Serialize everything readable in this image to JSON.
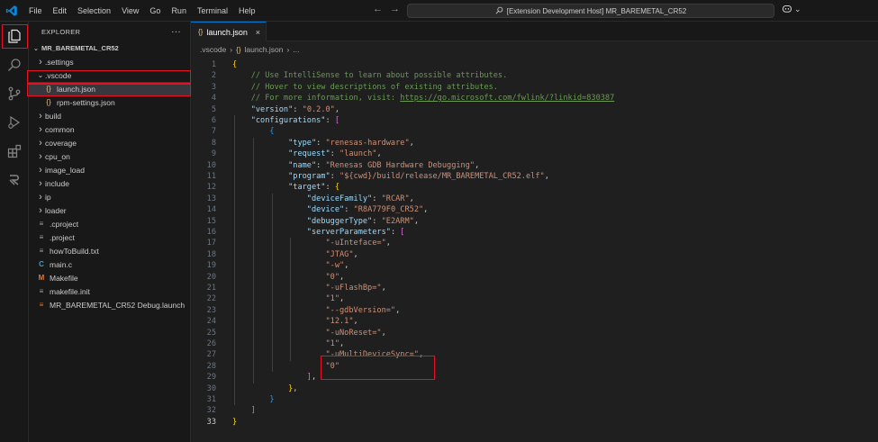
{
  "titlebar": {
    "menu": [
      "File",
      "Edit",
      "Selection",
      "View",
      "Go",
      "Run",
      "Terminal",
      "Help"
    ],
    "search_text": "[Extension Development Host] MR_BAREMETAL_CR52"
  },
  "sidebar": {
    "header": "EXPLORER",
    "more": "···",
    "root": "MR_BAREMETAL_CR52",
    "items": [
      {
        "label": ".settings",
        "kind": "folder",
        "depth": 1,
        "expanded": false
      },
      {
        "label": ".vscode",
        "kind": "folder",
        "depth": 1,
        "expanded": true
      },
      {
        "label": "launch.json",
        "kind": "json",
        "depth": 2,
        "selected": true
      },
      {
        "label": "rpm-settings.json",
        "kind": "json",
        "depth": 2
      },
      {
        "label": "build",
        "kind": "folder",
        "depth": 1,
        "expanded": false
      },
      {
        "label": "common",
        "kind": "folder",
        "depth": 1,
        "expanded": false
      },
      {
        "label": "coverage",
        "kind": "folder",
        "depth": 1,
        "expanded": false
      },
      {
        "label": "cpu_on",
        "kind": "folder",
        "depth": 1,
        "expanded": false
      },
      {
        "label": "image_load",
        "kind": "folder",
        "depth": 1,
        "expanded": false
      },
      {
        "label": "include",
        "kind": "folder",
        "depth": 1,
        "expanded": false
      },
      {
        "label": "ip",
        "kind": "folder",
        "depth": 1,
        "expanded": false
      },
      {
        "label": "loader",
        "kind": "folder",
        "depth": 1,
        "expanded": false
      },
      {
        "label": ".cproject",
        "kind": "file",
        "depth": 1
      },
      {
        "label": ".project",
        "kind": "file",
        "depth": 1
      },
      {
        "label": "howToBuild.txt",
        "kind": "file",
        "depth": 1
      },
      {
        "label": "main.c",
        "kind": "c",
        "depth": 1
      },
      {
        "label": "Makefile",
        "kind": "makefile",
        "depth": 1
      },
      {
        "label": "makefile.init",
        "kind": "file",
        "depth": 1
      },
      {
        "label": "MR_BAREMETAL_CR52 Debug.launch",
        "kind": "launch",
        "depth": 1
      }
    ]
  },
  "editor": {
    "tab_label": "launch.json",
    "tab_icon": "{}",
    "breadcrumb": [
      ".vscode",
      "launch.json",
      "..."
    ],
    "lines": [
      [
        [
          "{",
          "c-brace"
        ]
      ],
      [
        [
          "    // Use IntelliSense to learn about possible attributes.",
          "c-comment"
        ]
      ],
      [
        [
          "    // Hover to view descriptions of existing attributes.",
          "c-comment"
        ]
      ],
      [
        [
          "    // For more information, visit: ",
          "c-comment"
        ],
        [
          "https://go.microsoft.com/fwlink/?linkid=830387",
          "c-link"
        ]
      ],
      [
        [
          "    ",
          ""
        ],
        [
          "\"version\"",
          "c-key"
        ],
        [
          ": ",
          "c-punct"
        ],
        [
          "\"0.2.0\"",
          "c-str"
        ],
        [
          ",",
          "c-punct"
        ]
      ],
      [
        [
          "    ",
          ""
        ],
        [
          "\"configurations\"",
          "c-key"
        ],
        [
          ": ",
          "c-punct"
        ],
        [
          "[",
          "c-bracket2"
        ]
      ],
      [
        [
          "        ",
          ""
        ],
        [
          "{",
          "c-bracket3"
        ]
      ],
      [
        [
          "            ",
          ""
        ],
        [
          "\"type\"",
          "c-key"
        ],
        [
          ": ",
          "c-punct"
        ],
        [
          "\"renesas-hardware\"",
          "c-str"
        ],
        [
          ",",
          "c-punct"
        ]
      ],
      [
        [
          "            ",
          ""
        ],
        [
          "\"request\"",
          "c-key"
        ],
        [
          ": ",
          "c-punct"
        ],
        [
          "\"launch\"",
          "c-str"
        ],
        [
          ",",
          "c-punct"
        ]
      ],
      [
        [
          "            ",
          ""
        ],
        [
          "\"name\"",
          "c-key"
        ],
        [
          ": ",
          "c-punct"
        ],
        [
          "\"Renesas GDB Hardware Debugging\"",
          "c-str"
        ],
        [
          ",",
          "c-punct"
        ]
      ],
      [
        [
          "            ",
          ""
        ],
        [
          "\"program\"",
          "c-key"
        ],
        [
          ": ",
          "c-punct"
        ],
        [
          "\"${cwd}/build/release/MR_BAREMETAL_CR52.elf\"",
          "c-str"
        ],
        [
          ",",
          "c-punct"
        ]
      ],
      [
        [
          "            ",
          ""
        ],
        [
          "\"target\"",
          "c-key"
        ],
        [
          ": ",
          "c-punct"
        ],
        [
          "{",
          "c-brace"
        ]
      ],
      [
        [
          "                ",
          ""
        ],
        [
          "\"deviceFamily\"",
          "c-key"
        ],
        [
          ": ",
          "c-punct"
        ],
        [
          "\"RCAR\"",
          "c-str"
        ],
        [
          ",",
          "c-punct"
        ]
      ],
      [
        [
          "                ",
          ""
        ],
        [
          "\"device\"",
          "c-key"
        ],
        [
          ": ",
          "c-punct"
        ],
        [
          "\"R8A779F0_CR52\"",
          "c-str"
        ],
        [
          ",",
          "c-punct"
        ]
      ],
      [
        [
          "                ",
          ""
        ],
        [
          "\"debuggerType\"",
          "c-key"
        ],
        [
          ": ",
          "c-punct"
        ],
        [
          "\"E2ARM\"",
          "c-str"
        ],
        [
          ",",
          "c-punct"
        ]
      ],
      [
        [
          "                ",
          ""
        ],
        [
          "\"serverParameters\"",
          "c-key"
        ],
        [
          ": ",
          "c-punct"
        ],
        [
          "[",
          "c-bracket2"
        ]
      ],
      [
        [
          "                    ",
          ""
        ],
        [
          "\"-uInteface=\"",
          "c-str"
        ],
        [
          ",",
          "c-punct"
        ]
      ],
      [
        [
          "                    ",
          ""
        ],
        [
          "\"JTAG\"",
          "c-str"
        ],
        [
          ",",
          "c-punct"
        ]
      ],
      [
        [
          "                    ",
          ""
        ],
        [
          "\"-w\"",
          "c-str"
        ],
        [
          ",",
          "c-punct"
        ]
      ],
      [
        [
          "                    ",
          ""
        ],
        [
          "\"0\"",
          "c-str"
        ],
        [
          ",",
          "c-punct"
        ]
      ],
      [
        [
          "                    ",
          ""
        ],
        [
          "\"-uFlashBp=\"",
          "c-str"
        ],
        [
          ",",
          "c-punct"
        ]
      ],
      [
        [
          "                    ",
          ""
        ],
        [
          "\"1\"",
          "c-str"
        ],
        [
          ",",
          "c-punct"
        ]
      ],
      [
        [
          "                    ",
          ""
        ],
        [
          "\"--gdbVersion=\"",
          "c-str"
        ],
        [
          ",",
          "c-punct"
        ]
      ],
      [
        [
          "                    ",
          ""
        ],
        [
          "\"12.1\"",
          "c-str"
        ],
        [
          ",",
          "c-punct"
        ]
      ],
      [
        [
          "                    ",
          ""
        ],
        [
          "\"-uNoReset=\"",
          "c-str"
        ],
        [
          ",",
          "c-punct"
        ]
      ],
      [
        [
          "                    ",
          ""
        ],
        [
          "\"1\"",
          "c-str"
        ],
        [
          ",",
          "c-punct"
        ]
      ],
      [
        [
          "                    ",
          ""
        ],
        [
          "\"-uMultiDeviceSync=\"",
          "c-str"
        ],
        [
          ",",
          "c-punct"
        ]
      ],
      [
        [
          "                    ",
          ""
        ],
        [
          "\"0\"",
          "c-str"
        ]
      ],
      [
        [
          "                ",
          ""
        ],
        [
          "]",
          "c-bracket2"
        ],
        [
          ",",
          "c-punct"
        ]
      ],
      [
        [
          "            ",
          ""
        ],
        [
          "}",
          "c-brace"
        ],
        [
          ",",
          "c-punct"
        ]
      ],
      [
        [
          "        ",
          ""
        ],
        [
          "}",
          "c-bracket3"
        ]
      ],
      [
        [
          "    ",
          ""
        ],
        [
          "]",
          "c-bracket2"
        ]
      ],
      [
        [
          "}",
          "c-brace"
        ]
      ]
    ],
    "active_line": 33
  },
  "colors": {
    "accent": "#0078d4",
    "highlight": "#e81123"
  }
}
